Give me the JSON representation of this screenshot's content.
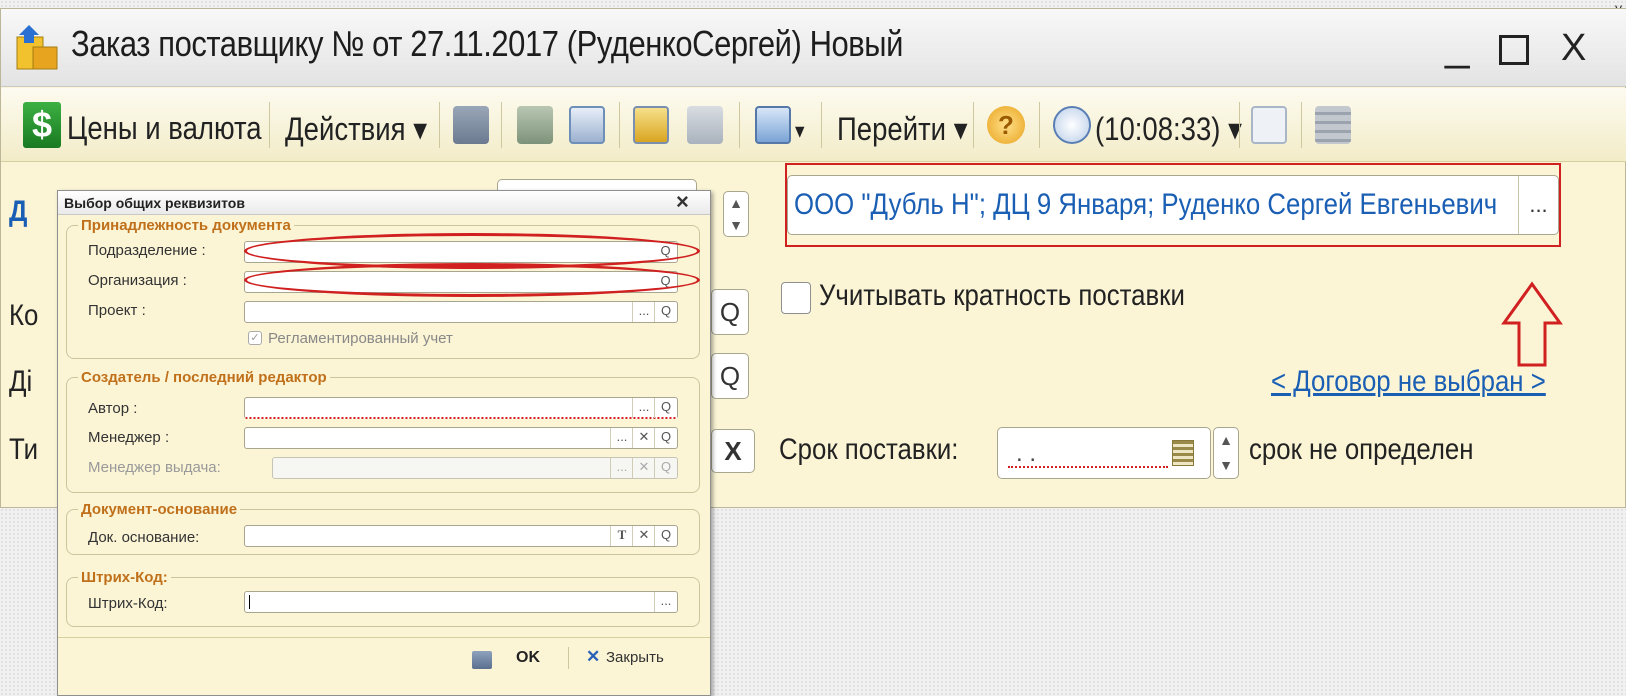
{
  "window": {
    "title": "Заказ поставщику № от 27.11.2017 (РуденкоСергей) Новый",
    "minimize": "_",
    "maximize": "☐",
    "close": "X"
  },
  "toolbar": {
    "prices": "Цены и валюта",
    "actions": "Действия ▾",
    "goto": "Перейти ▾",
    "help": "?",
    "time": "(10:08:33) ▾"
  },
  "form": {
    "org_value": "ООО \"Дубль Н\"; ДЦ 9 Января; Руденко Сергей Евгеньевич",
    "ellipsis": "...",
    "multiplicity_label": "Учитывать кратность поставки",
    "contract_link": "< Договор не выбран >",
    "delivery_label": "Срок поставки:",
    "delivery_value": ". .",
    "delivery_note": "срок не определен",
    "clipped": [
      "Д",
      "Ко",
      "Ді",
      "Ти"
    ]
  },
  "dialog": {
    "title": "Выбор общих реквизитов",
    "close": "×",
    "group1": "Принадлежность документа",
    "division": "Подразделение :",
    "organization": "Организация :",
    "project": "Проект :",
    "regulated": "Регламентированный учет",
    "group2": "Создатель / последний редактор",
    "author": "Автор :",
    "manager": "Менеджер :",
    "manager_issue": "Менеджер выдача:",
    "group3": "Документ-основание",
    "base_doc": "Док. основание:",
    "group4": "Штрих-Код:",
    "barcode": "Штрих-Код:",
    "ok": "OK",
    "close_btn": "Закрыть"
  },
  "colors": {
    "highlight": "#d02020",
    "link": "#1a5fb4",
    "group": "#c0701a"
  }
}
